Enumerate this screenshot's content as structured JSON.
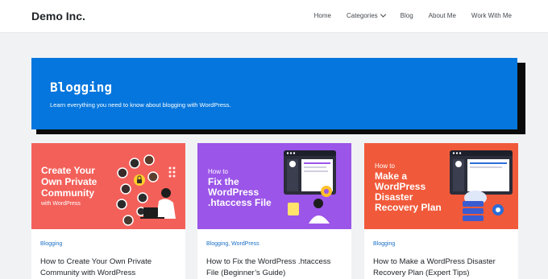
{
  "header": {
    "logo": "Demo Inc.",
    "nav": [
      {
        "label": "Home",
        "icon": ""
      },
      {
        "label": "Categories",
        "icon": "chevron-down-icon"
      },
      {
        "label": "Blog",
        "icon": ""
      },
      {
        "label": "About Me",
        "icon": ""
      },
      {
        "label": "Work With Me",
        "icon": ""
      }
    ]
  },
  "hero": {
    "title": "Blogging",
    "description": "Learn everything you need to know about blogging with WordPress.",
    "color": "#0476dd"
  },
  "cards": [
    {
      "image": {
        "lines": [
          "Create Your",
          "Own Private",
          "Community"
        ],
        "sub": "with WordPress",
        "bg": "#f3605a"
      },
      "categories": "Blogging",
      "title": "How to Create Your Own Private Community with WordPress"
    },
    {
      "image": {
        "pre": "How to",
        "lines": [
          "Fix the",
          "WordPress",
          ".htaccess File"
        ],
        "bg": "#9b55e8"
      },
      "categories": "Blogging, WordPress",
      "title": "How to Fix the WordPress .htaccess File (Beginner’s Guide)"
    },
    {
      "image": {
        "pre": "How to",
        "lines": [
          "Make a",
          "WordPress",
          "Disaster",
          "Recovery Plan"
        ],
        "bg": "#f05a3a"
      },
      "categories": "Blogging",
      "title": "How to Make a WordPress Disaster Recovery Plan (Expert Tips)"
    }
  ]
}
